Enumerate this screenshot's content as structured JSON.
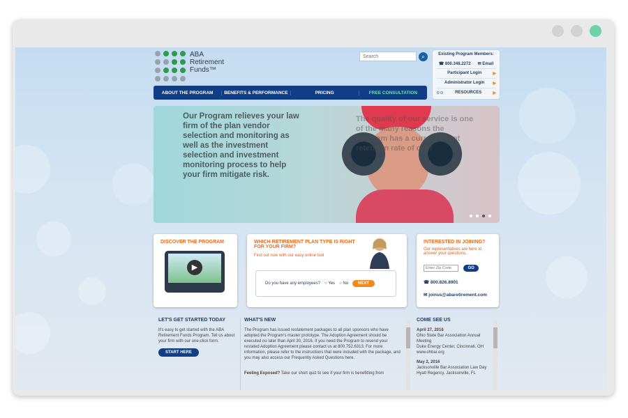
{
  "logo": {
    "line1": "ABA",
    "line2": "Retirement",
    "line3": "Funds™"
  },
  "search": {
    "placeholder": "Search"
  },
  "members": {
    "title": "Existing Program Members:",
    "phone": "800.348.2272",
    "email": "Email",
    "participant": "Participant Login",
    "admin": "Administrator Login",
    "resources": "RESOURCES"
  },
  "nav": [
    "ABOUT THE PROGRAM",
    "BENEFITS & PERFORMANCE",
    "PRICING",
    "FREE CONSULTATION"
  ],
  "hero": {
    "main_text": "Our Program relieves your law firm of the plan vendor selection and monitoring as well as the investment selection and investment monitoring process to help your firm mitigate risk.",
    "ghost_text": "The quality of our service is one of the many reasons the Program has a current client retention rate of over"
  },
  "cards": {
    "discover": {
      "title": "DISCOVER THE PROGRAM"
    },
    "plan": {
      "title": "WHICH RETIREMENT PLAN TYPE IS RIGHT FOR YOUR FIRM?",
      "sub": "Find out now with our easy online tool",
      "question": "Do you have any employees?",
      "yes": "Yes",
      "no": "No",
      "next": "NEXT"
    },
    "join": {
      "title": "INTERESTED IN JOINING?",
      "sub": "Our representatives are here to answer your questions.",
      "zip_placeholder": "Enter Zip Code",
      "go": "GO",
      "phone": "800.826.8901",
      "email": "joinus@abaretirement.com"
    }
  },
  "bottom": {
    "start": {
      "title": "LET'S GET STARTED TODAY",
      "text": "It's easy to get started with the ABA Retirement Funds Program. Tell us about your firm with our one-click form.",
      "button": "START HERE"
    },
    "news": {
      "title": "WHAT'S NEW",
      "text": "The Program has issued restatement packages to all plan sponsors who have adopted the Program's master prototype. The Adoption Agreement should be executed no later than April 30, 2016. If you need the Program to resend your restated Adoption Agreement please contact us at 800.752.6313. For more information, please refer to the instructions that were included with the package, and you may also access our Frequently Asked Questions here.",
      "feeling": "Feeling Exposed?",
      "feeling_text": "Take our short quiz to see if your firm is benefitting from"
    },
    "events": {
      "title": "COME SEE US",
      "items": [
        {
          "date": "April 27, 2016",
          "name": "Ohio State Bar Association Annual Meeting",
          "place": "Duke Energy Center, Cincinnati, OH",
          "url": "www.ohbar.org"
        },
        {
          "date": "May 2, 2016",
          "name": "Jacksonville Bar Association Law Day",
          "place": "Hyatt Regency, Jacksonville, FL",
          "url": ""
        }
      ]
    }
  }
}
